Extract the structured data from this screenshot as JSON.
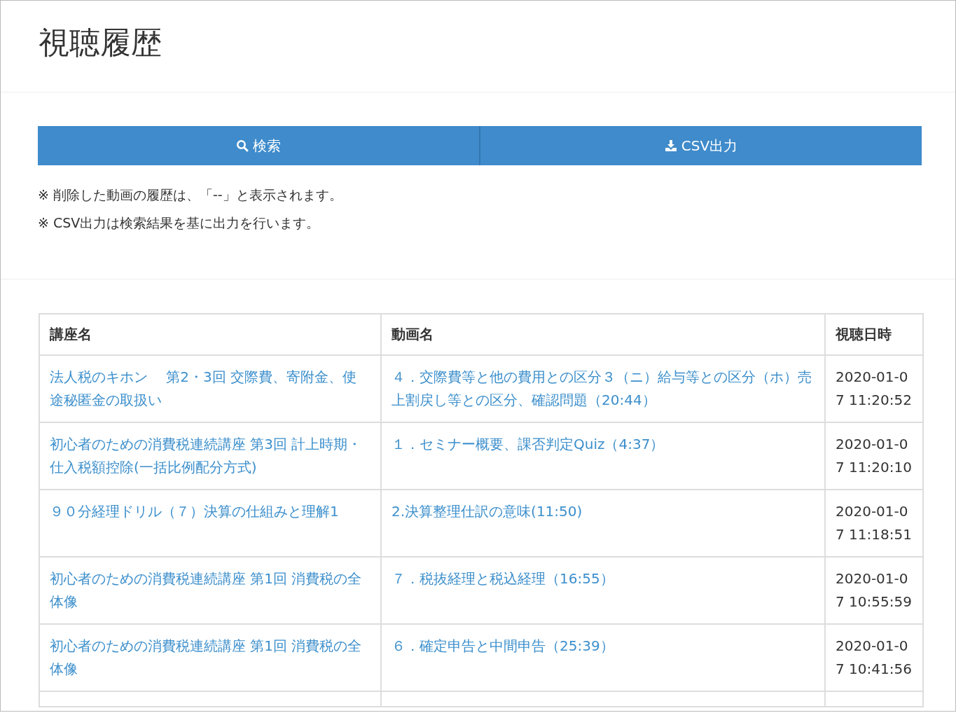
{
  "page": {
    "title": "視聴履歴"
  },
  "buttons": [
    {
      "kind": "search",
      "label": "検索"
    },
    {
      "kind": "download",
      "label": "CSV出力"
    }
  ],
  "notes": [
    "※ 削除した動画の履歴は、「--」と表示されます。",
    "※ CSV出力は検索結果を基に出力を行います。"
  ],
  "table": {
    "columns": [
      "講座名",
      "動画名",
      "視聴日時"
    ],
    "rows": [
      {
        "course": "法人税のキホン　 第2・3回 交際費、寄附金、使途秘匿金の取扱い",
        "video": "４．交際費等と他の費用との区分３（ニ）給与等との区分（ホ）売上割戻し等との区分、確認問題（20:44）",
        "viewed_at": "2020-01-07 11:20:52"
      },
      {
        "course": "初心者のための消費税連続講座 第3回 計上時期・仕入税額控除(一括比例配分方式)",
        "video": "１．セミナー概要、課否判定Quiz（4:37）",
        "viewed_at": "2020-01-07 11:20:10"
      },
      {
        "course": "９０分経理ドリル（７）決算の仕組みと理解1",
        "video": "2.決算整理仕訳の意味(11:50)",
        "viewed_at": "2020-01-07 11:18:51"
      },
      {
        "course": "初心者のための消費税連続講座 第1回 消費税の全体像",
        "video": "７．税抜経理と税込経理（16:55）",
        "viewed_at": "2020-01-07 10:55:59"
      },
      {
        "course": "初心者のための消費税連続講座 第1回 消費税の全体像",
        "video": "６．確定申告と中間申告（25:39）",
        "viewed_at": "2020-01-07 10:41:56"
      }
    ]
  }
}
